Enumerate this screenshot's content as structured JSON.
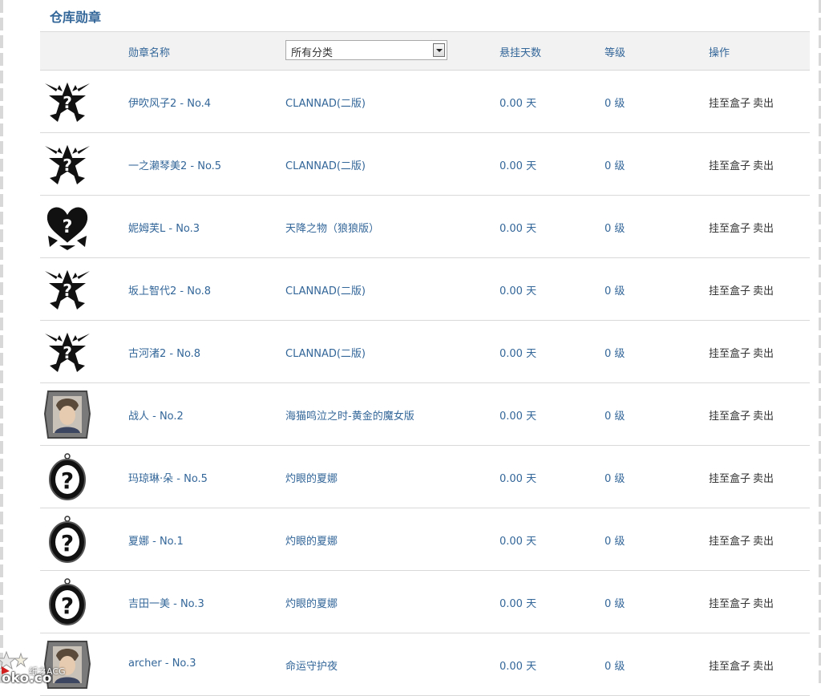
{
  "page": {
    "section_title": "仓库勋章"
  },
  "table": {
    "headers": {
      "name": "勋章名称",
      "category_select": "所有分类",
      "days": "悬挂天数",
      "level": "等级",
      "ops": "操作"
    },
    "rows": [
      {
        "name": "伊吹风子2 - No.4",
        "category": "CLANNAD(二版)",
        "days": "0.00 天",
        "level": "0 级",
        "hang": "挂至盒子",
        "sell": "卖出",
        "badge": "winged-star-badge-icon"
      },
      {
        "name": "一之濑琴美2 - No.5",
        "category": "CLANNAD(二版)",
        "days": "0.00 天",
        "level": "0 级",
        "hang": "挂至盒子",
        "sell": "卖出",
        "badge": "winged-star-badge-icon"
      },
      {
        "name": "妮姆芙L - No.3",
        "category": "天降之物（狼狼版）",
        "days": "0.00 天",
        "level": "0 级",
        "hang": "挂至盒子",
        "sell": "卖出",
        "badge": "winged-heart-badge-icon"
      },
      {
        "name": "坂上智代2 - No.8",
        "category": "CLANNAD(二版)",
        "days": "0.00 天",
        "level": "0 级",
        "hang": "挂至盒子",
        "sell": "卖出",
        "badge": "winged-star-badge-icon"
      },
      {
        "name": "古河渚2 - No.8",
        "category": "CLANNAD(二版)",
        "days": "0.00 天",
        "level": "0 级",
        "hang": "挂至盒子",
        "sell": "卖出",
        "badge": "winged-star-badge-icon"
      },
      {
        "name": "战人 - No.2",
        "category": "海猫鸣泣之时-黄金的魔女版",
        "days": "0.00 天",
        "level": "0 级",
        "hang": "挂至盒子",
        "sell": "卖出",
        "badge": "portrait-badge-icon"
      },
      {
        "name": "玛琼琳·朵 - No.5",
        "category": "灼眼的夏娜",
        "days": "0.00 天",
        "level": "0 级",
        "hang": "挂至盒子",
        "sell": "卖出",
        "badge": "oval-pendant-badge-icon"
      },
      {
        "name": "夏娜 - No.1",
        "category": "灼眼的夏娜",
        "days": "0.00 天",
        "level": "0 级",
        "hang": "挂至盒子",
        "sell": "卖出",
        "badge": "oval-pendant-badge-icon"
      },
      {
        "name": "吉田一美 - No.3",
        "category": "灼眼的夏娜",
        "days": "0.00 天",
        "level": "0 级",
        "hang": "挂至盒子",
        "sell": "卖出",
        "badge": "oval-pendant-badge-icon"
      },
      {
        "name": "archer - No.3",
        "category": "命运守护夜",
        "days": "0.00 天",
        "level": "0 级",
        "hang": "挂至盒子",
        "sell": "卖出",
        "badge": "portrait-badge-icon"
      }
    ]
  },
  "watermark": {
    "line1": "纸之ACG",
    "line2": "oko.co"
  },
  "colors": {
    "link_blue": "#336699",
    "header_bg": "#f2f2f2",
    "border": "#d9d9d9"
  }
}
